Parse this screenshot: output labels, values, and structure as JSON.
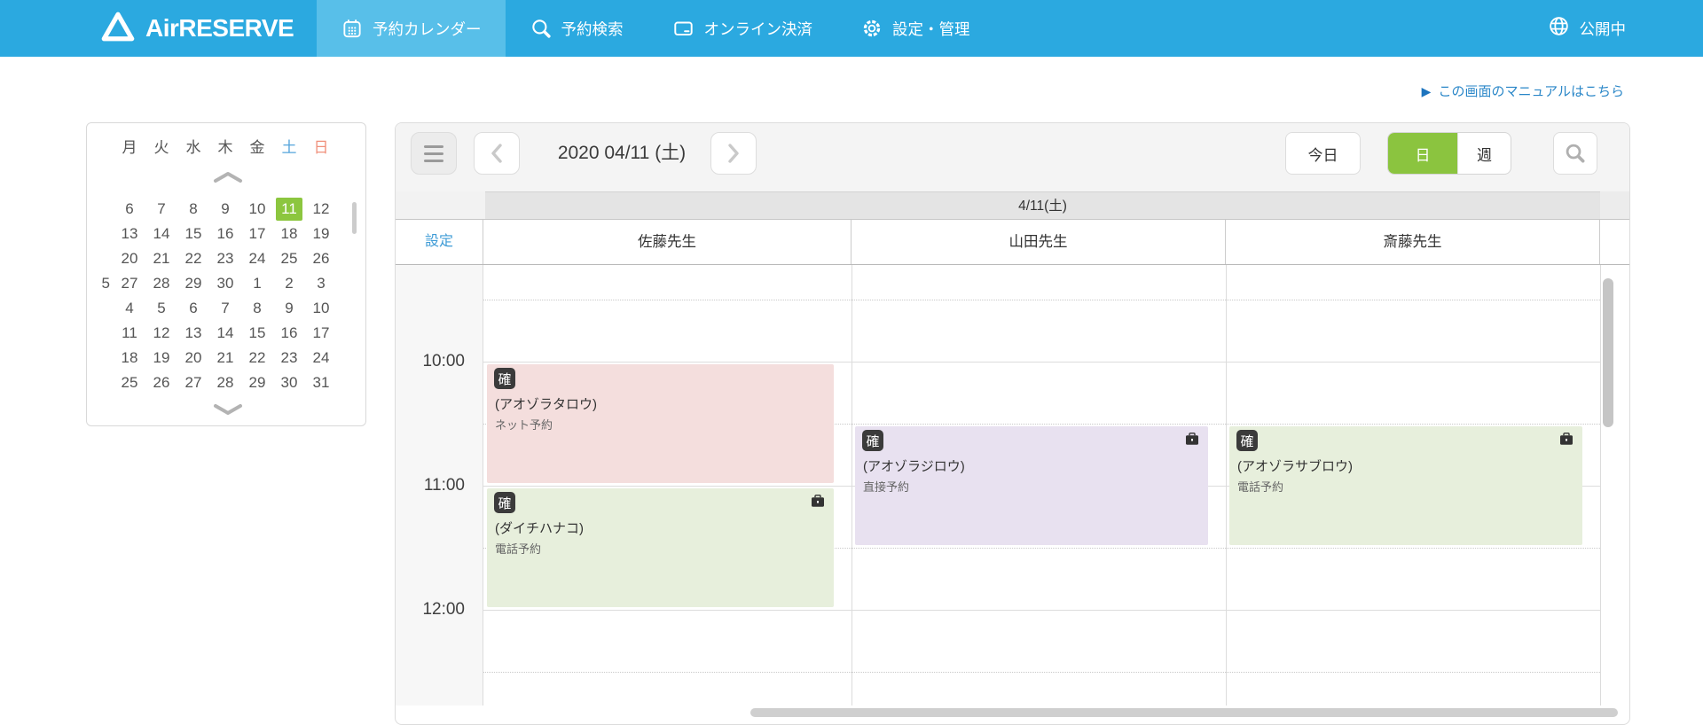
{
  "nav": {
    "logo_text": "AirRESERVE",
    "tabs": [
      {
        "label": "予約カレンダー",
        "icon": "calendar-icon",
        "active": true
      },
      {
        "label": "予約検索",
        "icon": "search-icon",
        "active": false
      },
      {
        "label": "オンライン決済",
        "icon": "card-icon",
        "active": false
      },
      {
        "label": "設定・管理",
        "icon": "gear-icon",
        "active": false
      }
    ],
    "status_label": "公開中",
    "colors": {
      "bar": "#2BA9E0",
      "active_tab": "#58BFE9"
    }
  },
  "manual_link": {
    "label": "この画面のマニュアルはこちら",
    "color": "#2B87C8"
  },
  "mini_calendar": {
    "day_headers": [
      {
        "label": "月",
        "color": "#555555"
      },
      {
        "label": "火",
        "color": "#555555"
      },
      {
        "label": "水",
        "color": "#555555"
      },
      {
        "label": "木",
        "color": "#555555"
      },
      {
        "label": "金",
        "color": "#555555"
      },
      {
        "label": "土",
        "color": "#55A5DB"
      },
      {
        "label": "日",
        "color": "#F0907B"
      }
    ],
    "weeks": [
      {
        "days": [
          "6",
          "7",
          "8",
          "9",
          "10",
          "11",
          "12"
        ]
      },
      {
        "days": [
          "13",
          "14",
          "15",
          "16",
          "17",
          "18",
          "19"
        ]
      },
      {
        "days": [
          "20",
          "21",
          "22",
          "23",
          "24",
          "25",
          "26"
        ]
      },
      {
        "days": [
          "27",
          "28",
          "29",
          "30",
          "1",
          "2",
          "3"
        ],
        "month_marker": "5"
      },
      {
        "days": [
          "4",
          "5",
          "6",
          "7",
          "8",
          "9",
          "10"
        ]
      },
      {
        "days": [
          "11",
          "12",
          "13",
          "14",
          "15",
          "16",
          "17"
        ]
      },
      {
        "days": [
          "18",
          "19",
          "20",
          "21",
          "22",
          "23",
          "24"
        ]
      },
      {
        "days": [
          "25",
          "26",
          "27",
          "28",
          "29",
          "30",
          "31"
        ]
      }
    ],
    "selected": {
      "week": 0,
      "day_index": 5,
      "color": "#8CC63F"
    }
  },
  "toolbar": {
    "date_label": "2020 04/11 (土)",
    "today_label": "今日",
    "day_label": "日",
    "week_label": "週",
    "active_view": "日",
    "active_color": "#8BC43F"
  },
  "schedule": {
    "date_header": "4/11(土)",
    "settings_label": "設定",
    "staff": [
      {
        "name": "佐藤先生"
      },
      {
        "name": "山田先生"
      },
      {
        "name": "斎藤先生"
      }
    ],
    "time_labels": [
      "10:00",
      "11:00",
      "12:00"
    ],
    "bookings": [
      {
        "staff": 0,
        "start": "10:00",
        "end": "11:00",
        "badge": "確",
        "name": "(アオゾラタロウ)",
        "channel": "ネット予約",
        "color": "#F4DEDD",
        "briefcase": false
      },
      {
        "staff": 0,
        "start": "11:00",
        "end": "12:00",
        "badge": "確",
        "name": "(ダイチハナコ)",
        "channel": "電話予約",
        "color": "#E7EFDC",
        "briefcase": true
      },
      {
        "staff": 1,
        "start": "10:30",
        "end": "11:30",
        "badge": "確",
        "name": "(アオゾラジロウ)",
        "channel": "直接予約",
        "color": "#E8E1F0",
        "briefcase": true
      },
      {
        "staff": 2,
        "start": "10:30",
        "end": "11:30",
        "badge": "確",
        "name": "(アオゾラサブロウ)",
        "channel": "電話予約",
        "color": "#E7EFDC",
        "briefcase": true
      }
    ]
  }
}
